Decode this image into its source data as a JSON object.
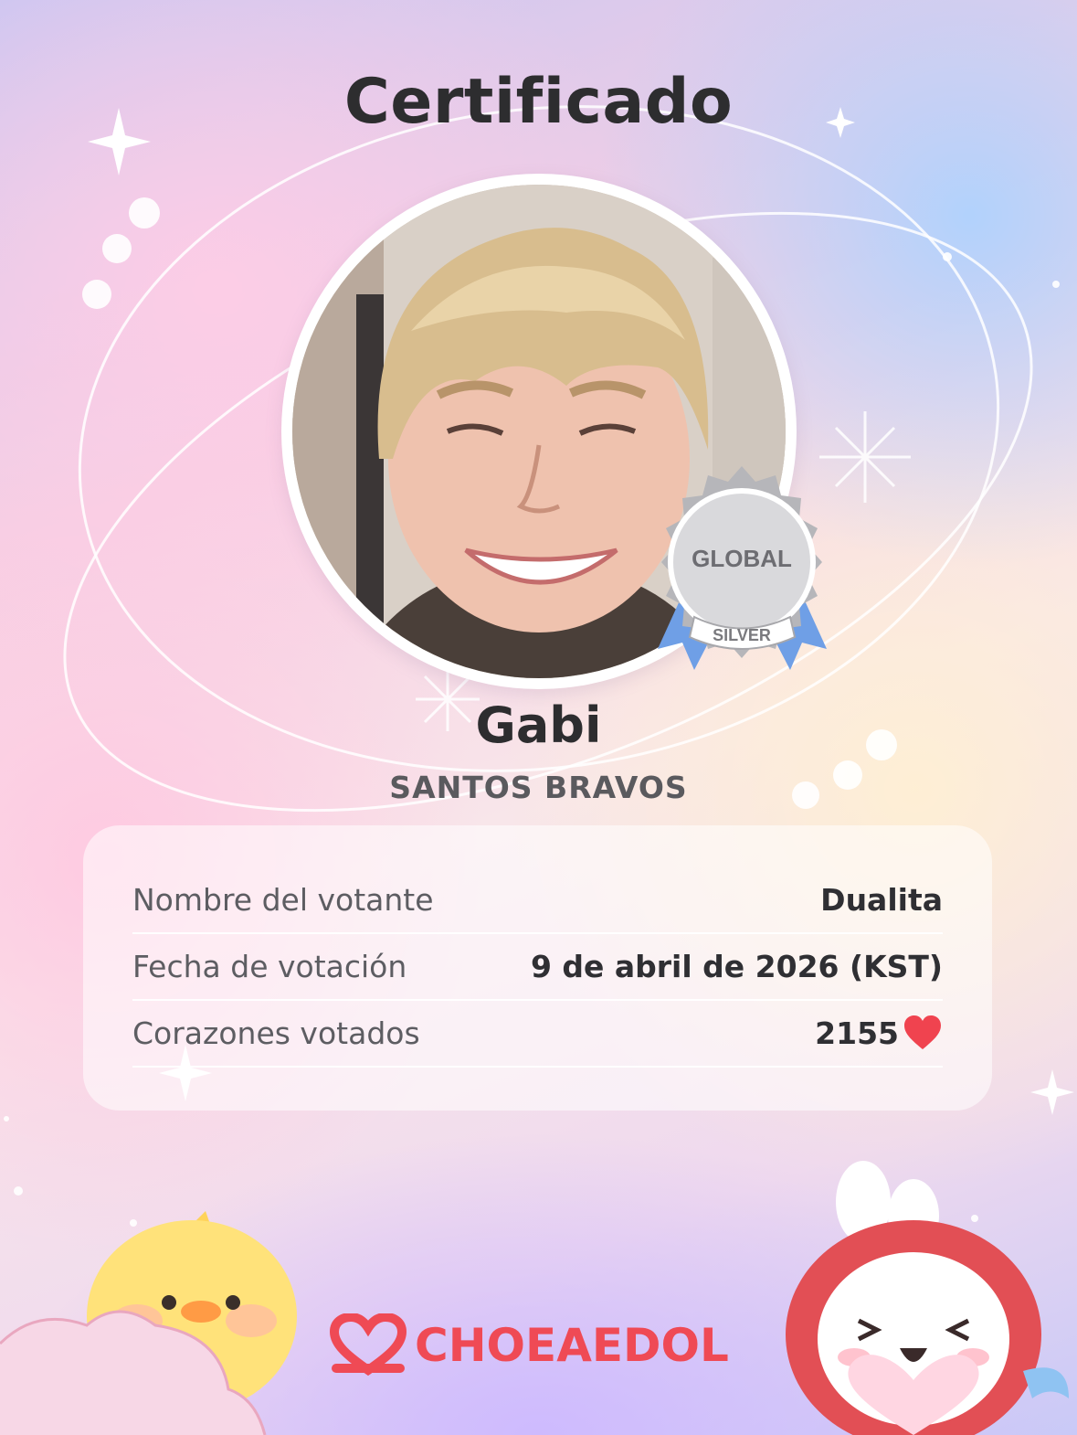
{
  "title": "Certificado",
  "idol": {
    "name": "Gabi",
    "group": "SANTOS BRAVOS"
  },
  "badge": {
    "top_text": "GLOBAL",
    "ribbon_text": "SILVER",
    "color": "#c9c9cc"
  },
  "info": {
    "voter": {
      "label": "Nombre del votante",
      "value": "Dualita"
    },
    "date": {
      "label": "Fecha de votación",
      "value": "9 de abril de 2026 (KST)"
    },
    "hearts": {
      "label": "Corazones votados",
      "value": "2155",
      "icon": "heart-icon"
    }
  },
  "brand": {
    "name": "CHOEAEDOL",
    "color": "#ef4a55"
  },
  "colors": {
    "heart": "#f0434f",
    "ribbon": "#6f9fe6"
  }
}
